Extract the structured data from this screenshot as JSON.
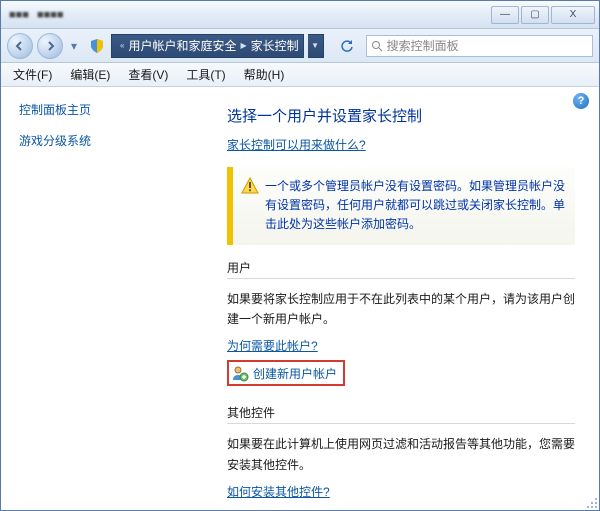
{
  "titlebar": {
    "left_blur1": "■■■",
    "left_blur2": "■■■■",
    "min": "—",
    "max": "▢",
    "close": "X"
  },
  "navbar": {
    "crumb1": "用户帐户和家庭安全",
    "crumb2": "家长控制",
    "search_placeholder": "搜索控制面板"
  },
  "menubar": {
    "file": "文件(F)",
    "edit": "编辑(E)",
    "view": "查看(V)",
    "tools": "工具(T)",
    "help": "帮助(H)"
  },
  "sidebar": {
    "home": "控制面板主页",
    "rating": "游戏分级系统"
  },
  "content": {
    "heading": "选择一个用户并设置家长控制",
    "what_link": "家长控制可以用来做什么?",
    "warn_text": "一个或多个管理员帐户没有设置密码。如果管理员帐户没有设置密码，任何用户就都可以跳过或关闭家长控制。单击此处为这些帐户添加密码。",
    "section_users": "用户",
    "users_body": "如果要将家长控制应用于不在此列表中的某个用户，请为该用户创建一个新用户帐户。",
    "why_link": "为何需要此帐户?",
    "create_link": "创建新用户帐户",
    "section_other": "其他控件",
    "other_body": "如果要在此计算机上使用网页过滤和活动报告等其他功能，您需要安装其他控件。",
    "install_link": "如何安装其他控件?"
  }
}
